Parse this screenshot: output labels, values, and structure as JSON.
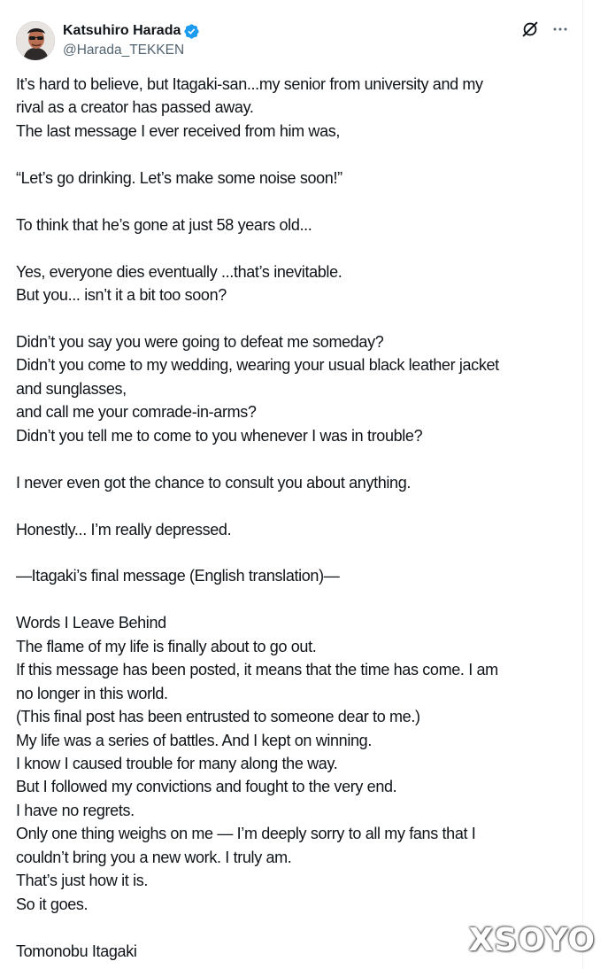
{
  "author": {
    "display_name": "Katsuhiro Harada",
    "handle": "@Harada_TEKKEN",
    "verified": true,
    "verified_color": "#1d9bf0"
  },
  "actions": {
    "grok_icon": "grok-icon",
    "more_icon": "more-horizontal-icon"
  },
  "tweet_lines": [
    "It’s hard to believe, but Itagaki-san...my senior from university and my",
    "rival as a creator has passed away.",
    "The last message I ever received from him was,",
    "",
    "“Let’s go drinking. Let’s make some noise soon!”",
    "",
    "To think that he’s gone at just 58 years old...",
    "",
    "Yes, everyone dies eventually ...that’s inevitable.",
    "But you... isn’t it a bit too soon?",
    "",
    "Didn’t you say you were going to defeat me someday?",
    "Didn’t you come to my wedding, wearing your usual black leather jacket",
    "and sunglasses,",
    "and call me your comrade-in-arms?",
    "Didn’t you tell me to come to you whenever I was in trouble?",
    "",
    "I never even got the chance to consult you about anything.",
    "",
    "Honestly... I’m really depressed.",
    "",
    "—Itagaki’s final message (English translation)—",
    "",
    "Words I Leave Behind",
    "The flame of my life is finally about to go out.",
    "If this message has been posted, it means that the time has come. I am",
    "no longer in this world.",
    "(This final post has been entrusted to someone dear to me.)",
    "My life was a series of battles. And I kept on winning.",
    "I know I caused trouble for many along the way.",
    "But I followed my convictions and fought to the very end.",
    "I have no regrets.",
    "Only one thing weighs on me — I’m deeply sorry to all my fans that I",
    "couldn’t bring you a new work. I truly am.",
    "That’s just how it is.",
    "So it goes.",
    "",
    "Tomonobu Itagaki"
  ],
  "watermark": "XSOYO"
}
